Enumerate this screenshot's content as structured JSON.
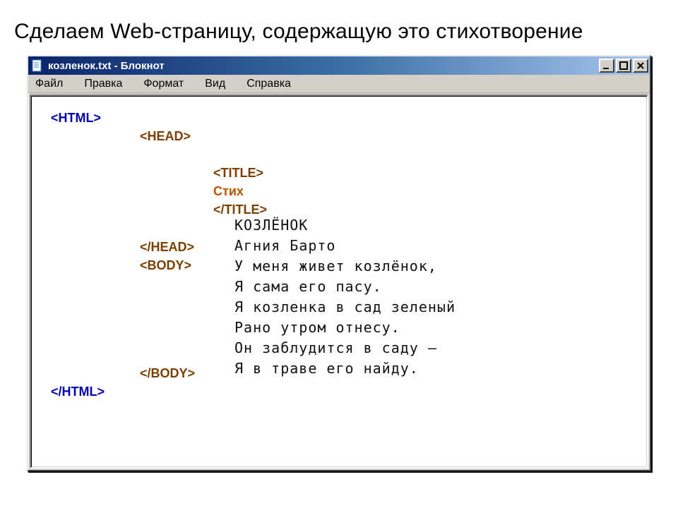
{
  "slide": {
    "heading": "Сделаем Web-страницу, содержащую это стихотворение"
  },
  "window": {
    "title": "козленок.txt - Блокнот",
    "menus": {
      "file": "Файл",
      "edit": "Правка",
      "format": "Формат",
      "view": "Вид",
      "help": "Справка"
    }
  },
  "code": {
    "html_open": "<HTML>",
    "head_open": "<HEAD>",
    "title_open": "<TITLE>",
    "title_text": "Стих ",
    "title_close": "</TITLE>",
    "head_close": "</HEAD>",
    "body_open": "<BODY>",
    "body_close": "</BODY>",
    "html_close": "</HTML>"
  },
  "poem": {
    "l1": "КОЗЛЁНОК",
    "l2": "Агния Барто",
    "l3": "У меня живет козлёнок,",
    "l4": "Я сама его пасу.",
    "l5": "Я козленка в сад зеленый",
    "l6": "Рано утром отнесу.",
    "l7": "Он заблудится в саду –",
    "l8": "Я в траве его найду."
  }
}
